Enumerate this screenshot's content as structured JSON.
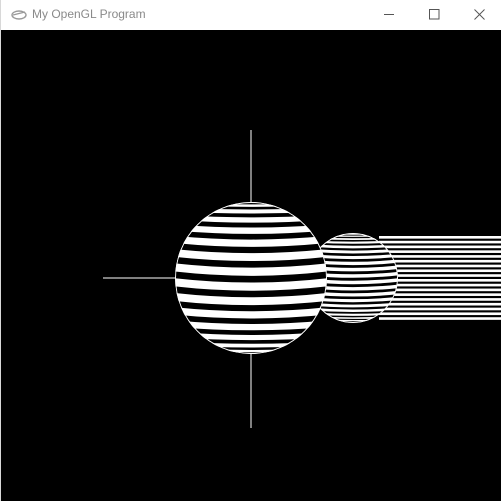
{
  "window": {
    "title": "My OpenGL Program",
    "icon": "opengl-app-icon",
    "controls": [
      "minimize-icon",
      "maximize-icon",
      "close-icon"
    ]
  },
  "scene": {
    "background": "#000000",
    "foreground": "#ffffff",
    "objects": [
      "axis-lines",
      "striped-sphere",
      "striped-small-sphere",
      "striped-cylinder"
    ]
  }
}
